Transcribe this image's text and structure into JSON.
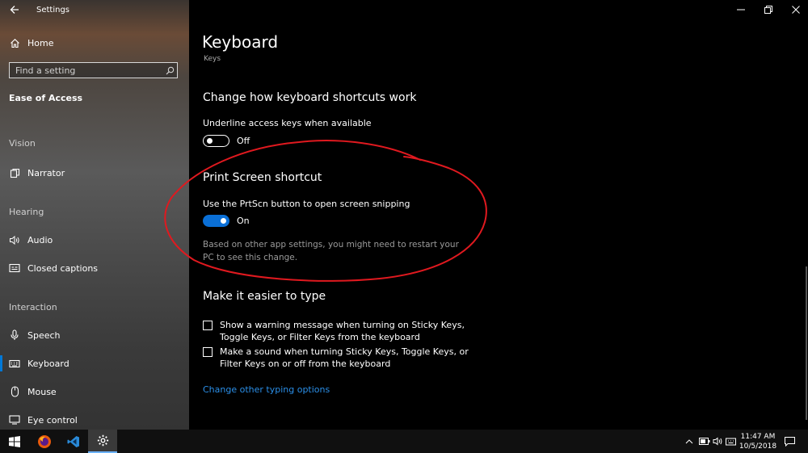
{
  "window": {
    "title": "Settings"
  },
  "sidebar": {
    "home": "Home",
    "search_placeholder": "Find a setting",
    "category": "Ease of Access",
    "sections": [
      {
        "heading": "Vision",
        "items": [
          "Narrator"
        ]
      },
      {
        "heading": "Hearing",
        "items": [
          "Audio",
          "Closed captions"
        ]
      },
      {
        "heading": "Interaction",
        "items": [
          "Speech",
          "Keyboard",
          "Mouse",
          "Eye control"
        ]
      }
    ],
    "active_item": "Keyboard"
  },
  "page": {
    "title": "Keyboard",
    "subtitle": "Keys",
    "shortcuts": {
      "heading": "Change how keyboard shortcuts work",
      "underline_label": "Underline access keys when available",
      "underline_state": "Off"
    },
    "print_screen": {
      "heading": "Print Screen shortcut",
      "label": "Use the PrtScn button to open screen snipping",
      "state": "On",
      "note": "Based on other app settings, you might need to restart your PC to see this change."
    },
    "typing": {
      "heading": "Make it easier to type",
      "checkbox1": "Show a warning message when turning on Sticky Keys, Toggle Keys, or Filter Keys from the keyboard",
      "checkbox2": "Make a sound when turning Sticky Keys, Toggle Keys, or Filter Keys on or off from the keyboard",
      "link": "Change other typing options"
    }
  },
  "taskbar": {
    "time": "11:47 AM",
    "date": "10/5/2018"
  },
  "colors": {
    "accent": "#0a6fd6",
    "link": "#2b8fe8",
    "annotation": "#e0191f"
  }
}
